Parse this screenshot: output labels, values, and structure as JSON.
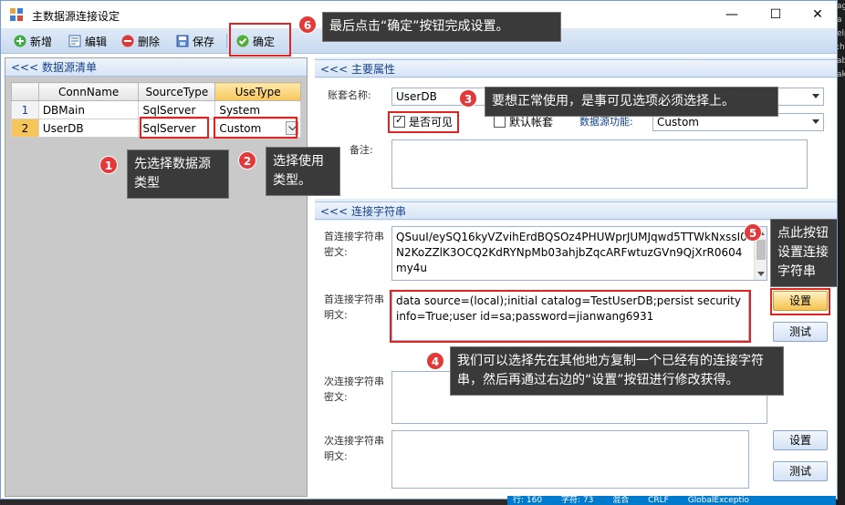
{
  "window": {
    "title": "主数据源连接设定",
    "minimize": "—",
    "maximize": "☐",
    "close": "✕"
  },
  "toolbar": {
    "new": "新增",
    "edit": "编辑",
    "delete": "删除",
    "save": "保存",
    "confirm": "确定"
  },
  "left": {
    "header": "<<< 数据源清单",
    "columns": [
      "ConnName",
      "SourceType",
      "UseType"
    ],
    "rows": [
      {
        "num": "1",
        "conn": "DBMain",
        "source": "SqlServer",
        "use": "System"
      },
      {
        "num": "2",
        "conn": "UserDB",
        "source": "SqlServer",
        "use": "Custom"
      }
    ]
  },
  "main": {
    "header": "<<< 主要属性",
    "account_label": "账套名称:",
    "account_value": "UserDB",
    "visible_label": "是否可见",
    "visible_checked": true,
    "default_label": "默认帐套",
    "default_checked": false,
    "func_label": "数据源功能:",
    "func_value": "Custom",
    "remark_label": "备注:",
    "remark_value": ""
  },
  "conn": {
    "header": "<<< 连接字符串",
    "primary_cipher_label": "首连接字符串密文:",
    "primary_cipher_value": "QSuuI/eySQ16kyVZvihErdBQSOz4PHUWprJUMJqwd5TTWkNxssI0N2KoZZlK3OCQ2KdRYNpMb03ahjbZqcARFwtuzGVn9QjXrR0604my4u",
    "primary_plain_label": "首连接字符串明文:",
    "primary_plain_value": "data source=(local);initial catalog=TestUserDB;persist security info=True;user id=sa;password=jianwang6931",
    "secondary_cipher_label": "次连接字符串密文:",
    "secondary_plain_label": "次连接字符串明文:",
    "set_label": "设置",
    "test_label": "测试"
  },
  "callouts": {
    "c1": "先选择数据源类型",
    "c2": "选择使用类型。",
    "c3": "要想正常使用，是事可见选项必须选择上。",
    "c4": "我们可以选择先在其他地方复制一个已经有的连接字符串，然后再通过右边的“设置”按钮进行修改获得。",
    "c5": "点此按钮设置连接字符串",
    "c6": "最后点击“确定”按钮完成设置。"
  },
  "status": {
    "line": "行: 160",
    "char": "字符: 73",
    "mode": "混合",
    "crlf": "CRLF",
    "extra": "GlobalExceptio"
  },
  "colors": {
    "accent": "#15428b",
    "highlight": "#f7c65b",
    "annotation_red": "#e02424"
  }
}
